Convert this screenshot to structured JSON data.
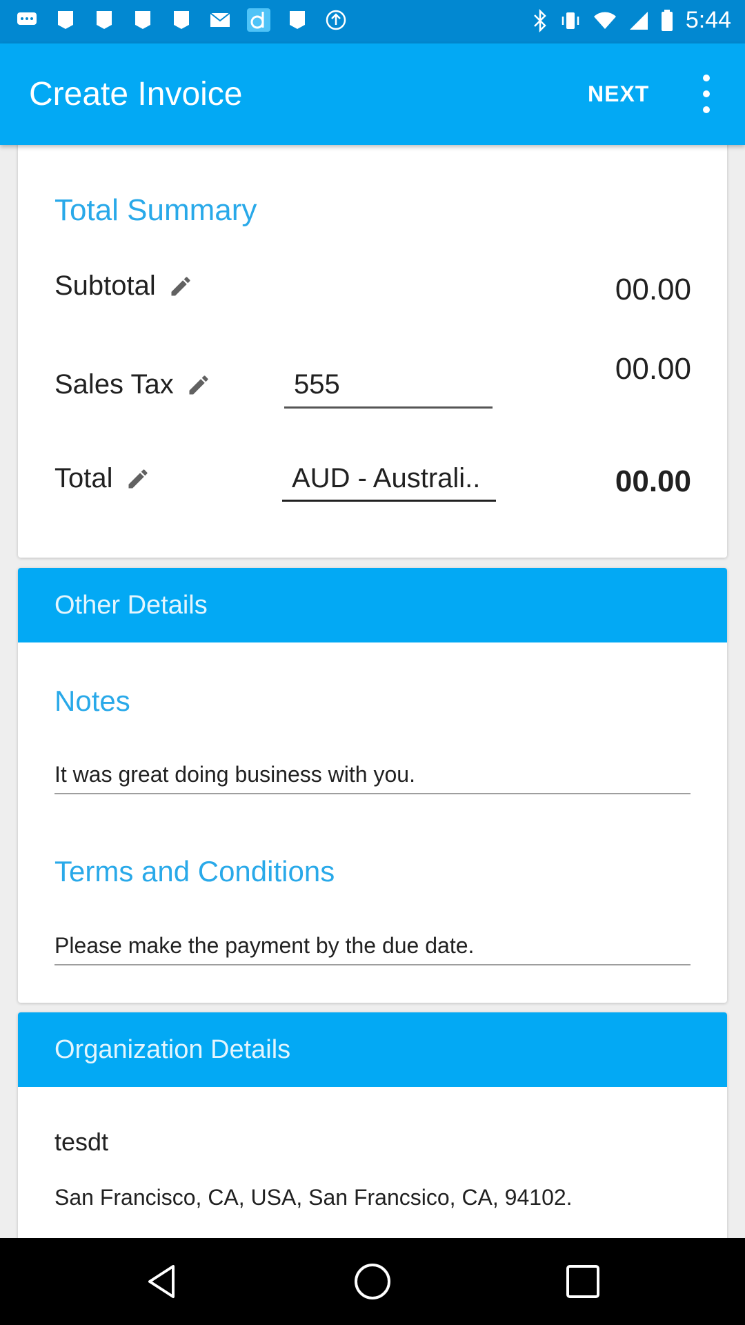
{
  "status_bar": {
    "time": "5:44",
    "left_icons": [
      "chat-icon",
      "photo-icon",
      "photo-icon",
      "photo-icon",
      "photo-icon",
      "email-icon",
      "app-d-icon",
      "photo-icon",
      "upload-icon"
    ],
    "right_icons": [
      "bluetooth-icon",
      "vibrate-icon",
      "wifi-icon",
      "signal-icon",
      "battery-icon"
    ]
  },
  "app_bar": {
    "title": "Create Invoice",
    "next_label": "NEXT",
    "menu_icon": "more-vert-icon"
  },
  "total_summary": {
    "title": "Total Summary",
    "subtotal_label": "Subtotal",
    "subtotal_amount": "00.00",
    "sales_tax_label": "Sales Tax",
    "sales_tax_value": "555",
    "sales_tax_amount": "00.00",
    "total_label": "Total",
    "currency_value": "AUD - Australi..",
    "total_amount": "00.00"
  },
  "other_details": {
    "header": "Other Details",
    "notes_title": "Notes",
    "notes_value": "It was great doing business with you.",
    "terms_title": "Terms and Conditions",
    "terms_value": "Please make the payment by the due date."
  },
  "organization_details": {
    "header": "Organization Details",
    "name": "tesdt",
    "address": "San Francisco, CA, USA, San Francsico, CA, 94102."
  },
  "nav_bar": {
    "buttons": [
      "back-icon",
      "home-icon",
      "recents-icon"
    ]
  },
  "colors": {
    "primary": "#03a9f4",
    "primary_dark": "#0288d1",
    "accent_text": "#29a9e9"
  }
}
